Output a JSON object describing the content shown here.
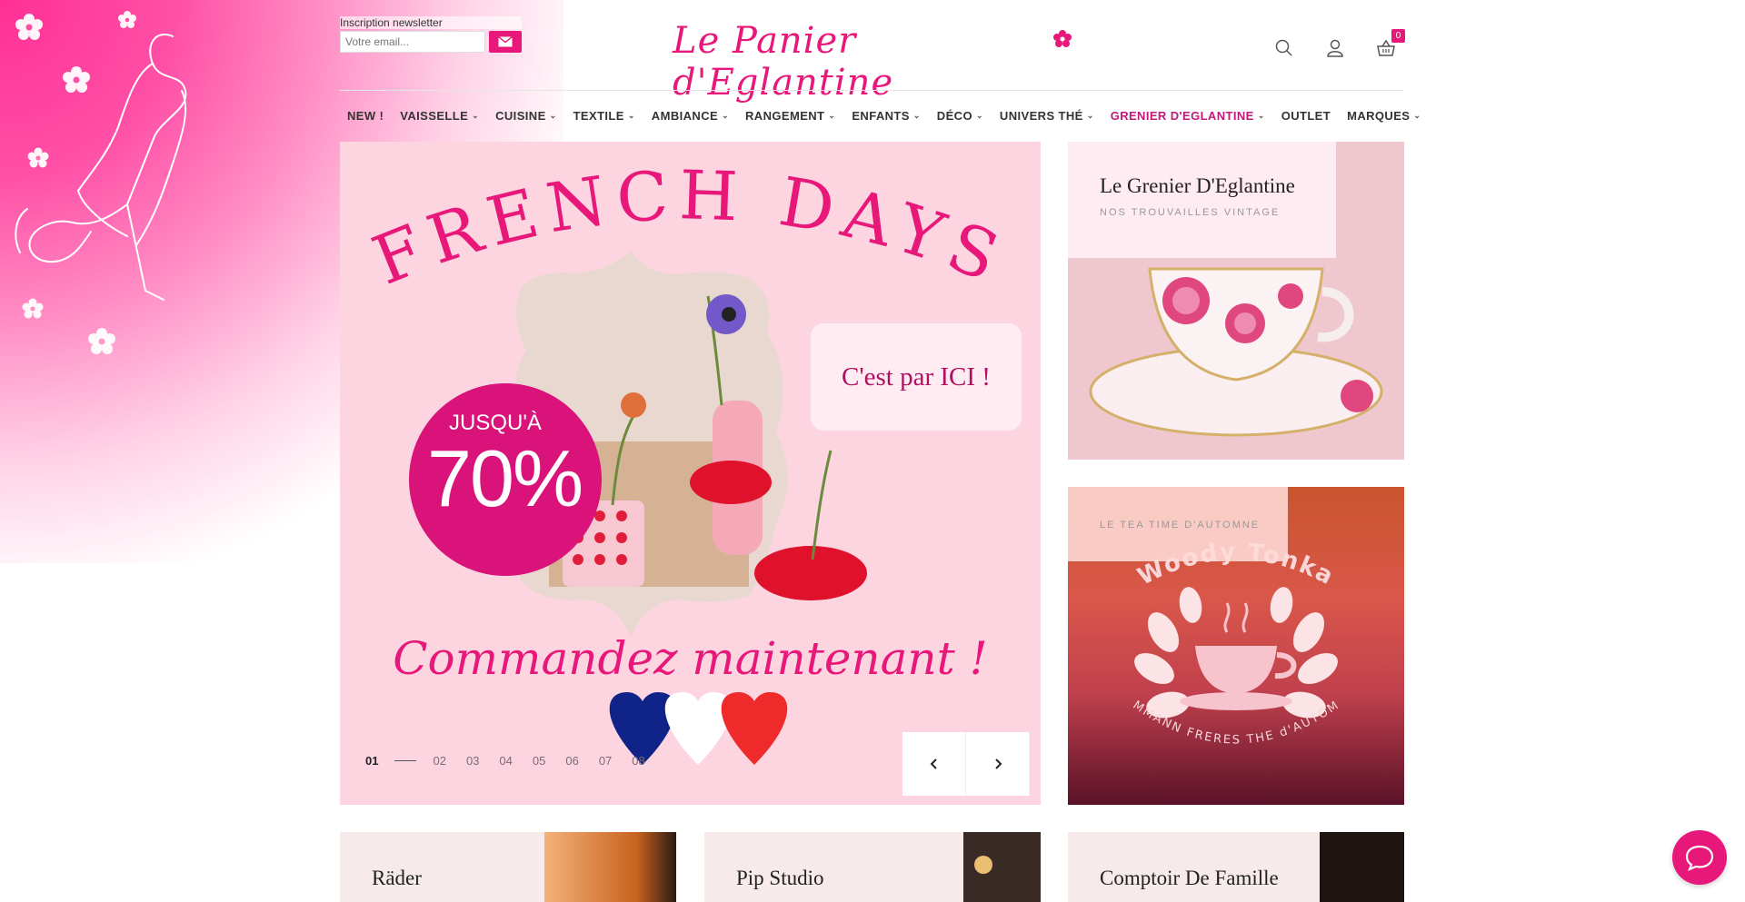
{
  "header": {
    "newsletter_label": "Inscription newsletter",
    "newsletter_placeholder": "Votre email...",
    "logo_text": "Le Panier d'Eglantine",
    "cart_count": "0"
  },
  "nav": {
    "items": [
      {
        "label": "NEW !",
        "has_caret": false
      },
      {
        "label": "VAISSELLE",
        "has_caret": true
      },
      {
        "label": "CUISINE",
        "has_caret": true
      },
      {
        "label": "TEXTILE",
        "has_caret": true
      },
      {
        "label": "AMBIANCE",
        "has_caret": true
      },
      {
        "label": "RANGEMENT",
        "has_caret": true
      },
      {
        "label": "ENFANTS",
        "has_caret": true
      },
      {
        "label": "DÉCO",
        "has_caret": true
      },
      {
        "label": "UNIVERS THÉ",
        "has_caret": true
      },
      {
        "label": "GRENIER D'EGLANTINE",
        "has_caret": true,
        "active": true
      },
      {
        "label": "OUTLET",
        "has_caret": false
      },
      {
        "label": "MARQUES",
        "has_caret": true
      }
    ],
    "caret": "⌄"
  },
  "hero": {
    "headline": "FRENCH DAYS",
    "promo_top": "JUSQU'À",
    "promo_value": "70%",
    "cta": "C'est par ICI !",
    "subline": "Commandez maintenant !",
    "pager": [
      "01",
      "02",
      "03",
      "04",
      "05",
      "06",
      "07",
      "08"
    ],
    "active_page": "01"
  },
  "cards": {
    "grenier": {
      "title": "Le Grenier D'Eglantine",
      "subtitle": "NOS TROUVAILLES VINTAGE"
    },
    "tea": {
      "subtitle": "LE TEA TIME D'AUTOMNE",
      "brand_arc": "Woody Tonka",
      "bottom_arc": "DAMMANN FRERES THE d'AUTOMNE"
    }
  },
  "tiles": [
    {
      "title": "Räder"
    },
    {
      "title": "Pip Studio"
    },
    {
      "title": "Comptoir De Famille"
    }
  ],
  "colors": {
    "accent": "#e8187a",
    "active_nav": "#c2187a",
    "hero_bg": "#fcd5e1"
  }
}
